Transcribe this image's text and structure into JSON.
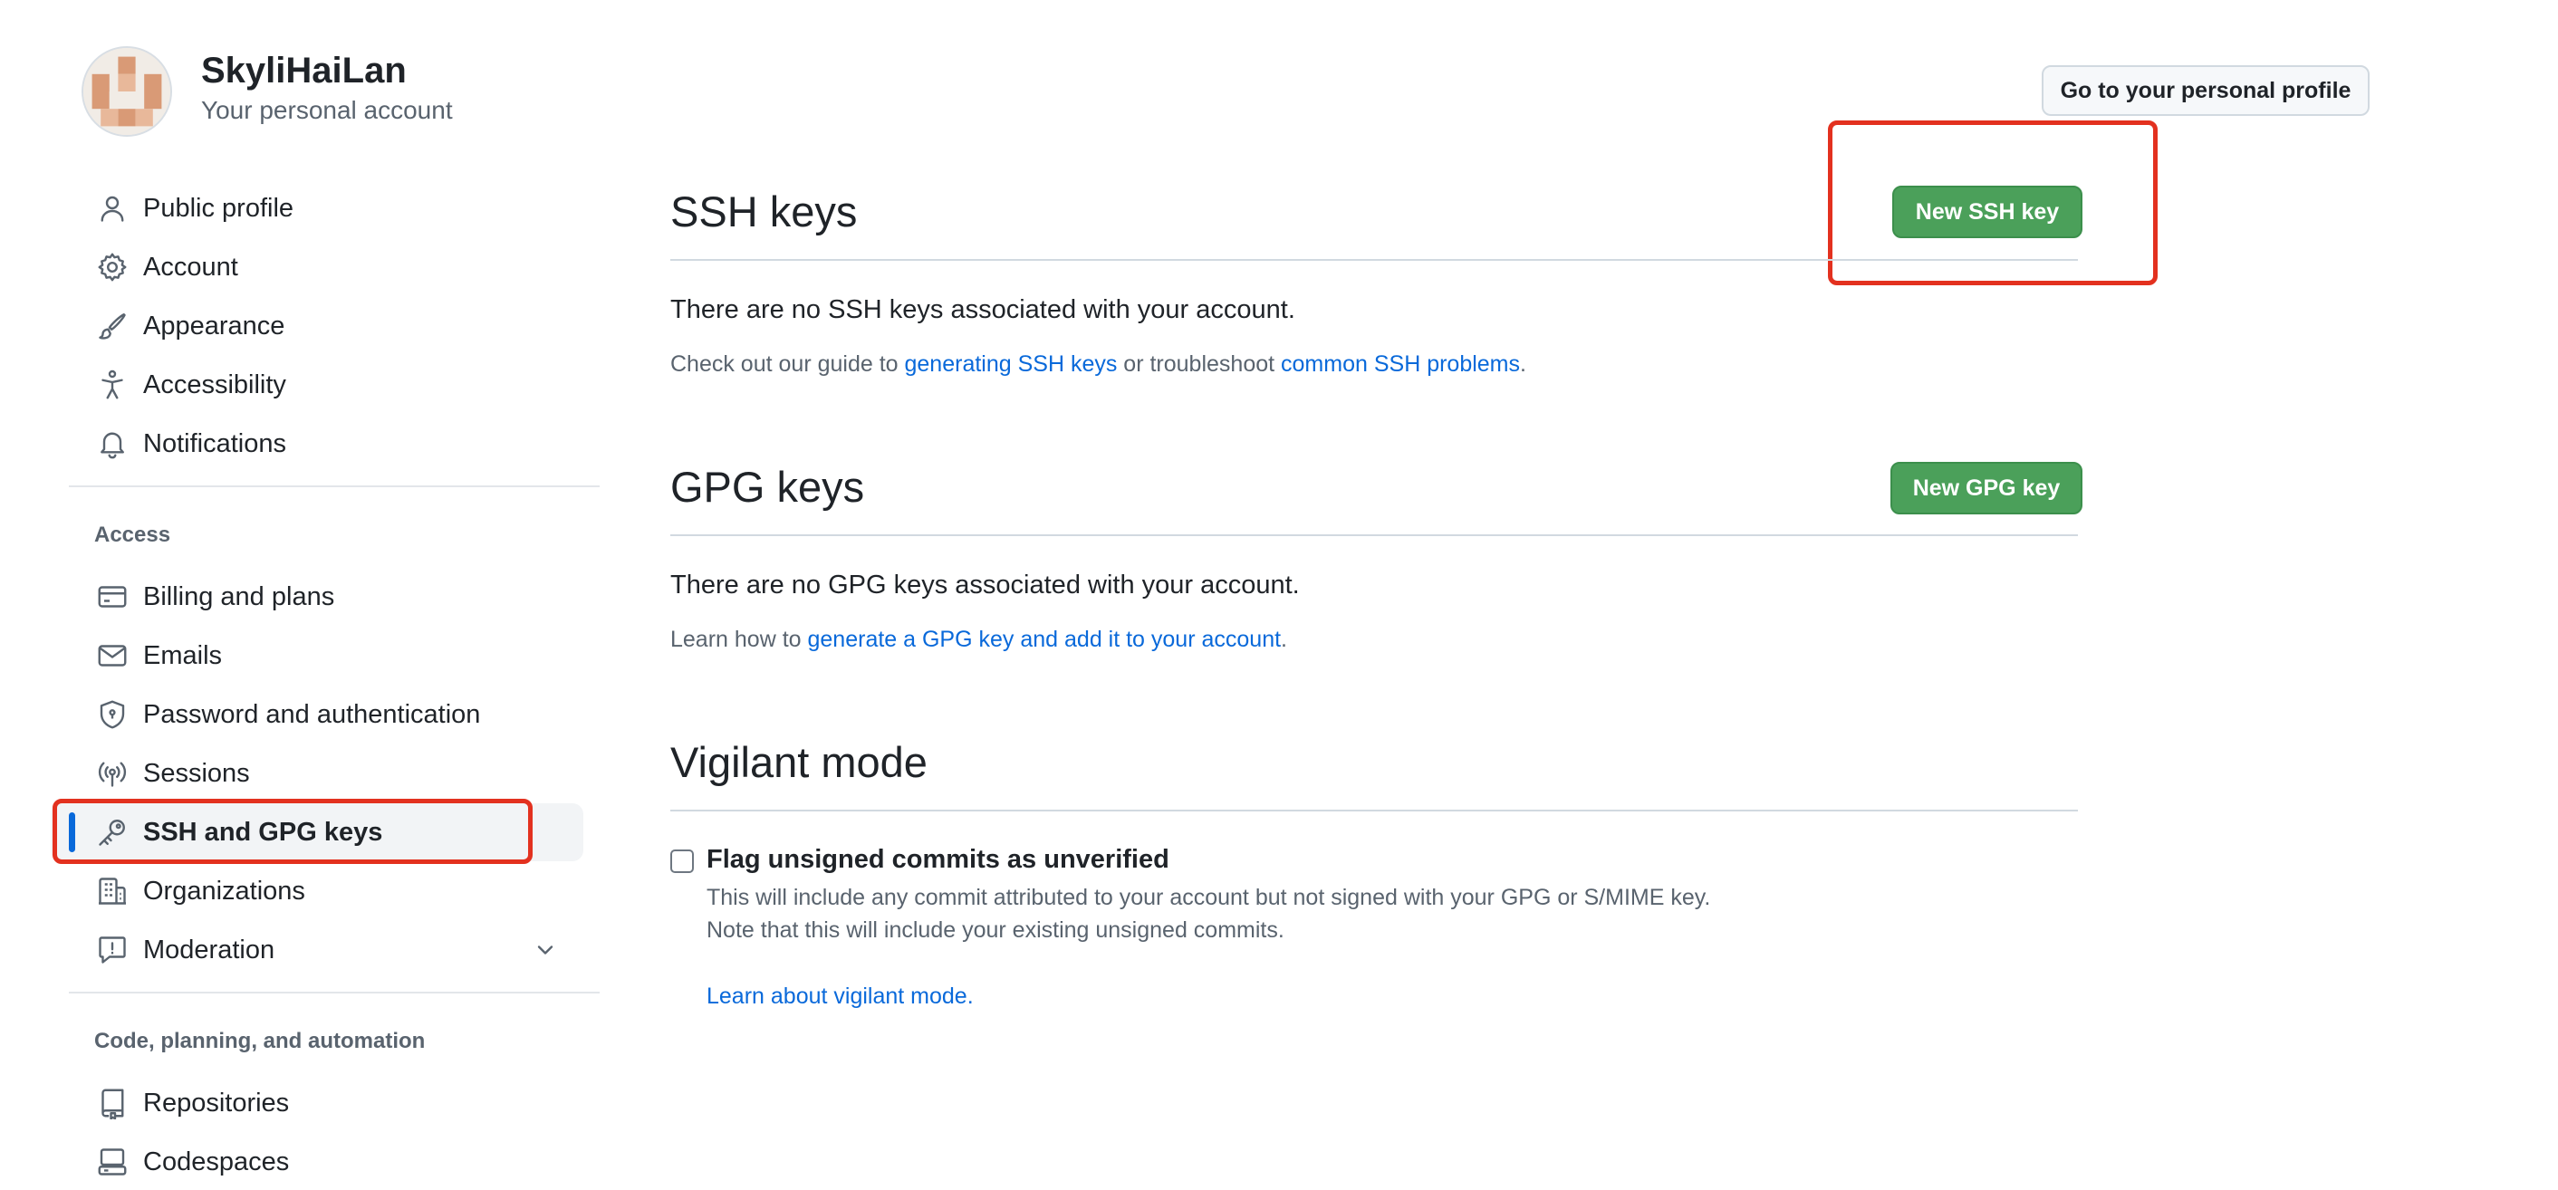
{
  "account": {
    "name": "SkyliHaiLan",
    "subtitle": "Your personal account",
    "profile_button": "Go to your personal profile"
  },
  "sidebar": {
    "items_top": [
      {
        "label": "Public profile",
        "icon": "person-icon"
      },
      {
        "label": "Account",
        "icon": "gear-icon"
      },
      {
        "label": "Appearance",
        "icon": "paintbrush-icon"
      },
      {
        "label": "Accessibility",
        "icon": "accessibility-icon"
      },
      {
        "label": "Notifications",
        "icon": "bell-icon"
      }
    ],
    "access_heading": "Access",
    "items_access": [
      {
        "label": "Billing and plans",
        "icon": "credit-card-icon"
      },
      {
        "label": "Emails",
        "icon": "mail-icon"
      },
      {
        "label": "Password and authentication",
        "icon": "shield-lock-icon"
      },
      {
        "label": "Sessions",
        "icon": "broadcast-icon"
      },
      {
        "label": "SSH and GPG keys",
        "icon": "key-icon",
        "active": true
      },
      {
        "label": "Organizations",
        "icon": "organization-icon"
      },
      {
        "label": "Moderation",
        "icon": "report-icon"
      }
    ],
    "code_heading": "Code, planning, and automation",
    "items_code": [
      {
        "label": "Repositories",
        "icon": "repo-icon"
      },
      {
        "label": "Codespaces",
        "icon": "codespaces-icon"
      }
    ]
  },
  "ssh": {
    "title": "SSH keys",
    "new_button": "New SSH key",
    "empty_text": "There are no SSH keys associated with your account.",
    "guide_prefix": "Check out our guide to ",
    "guide_link": "generating SSH keys",
    "guide_middle": " or troubleshoot ",
    "problems_link": "common SSH problems",
    "guide_suffix": "."
  },
  "gpg": {
    "title": "GPG keys",
    "new_button": "New GPG key",
    "empty_text": "There are no GPG keys associated with your account.",
    "learn_prefix": "Learn how to ",
    "learn_link": "generate a GPG key and add it to your account",
    "learn_suffix": "."
  },
  "vigilant": {
    "title": "Vigilant mode",
    "checkbox_label": "Flag unsigned commits as unverified",
    "checked": false,
    "desc_line1": "This will include any commit attributed to your account but not signed with your GPG or S/MIME key.",
    "desc_line2": "Note that this will include your existing unsigned commits.",
    "learn_link": "Learn about vigilant mode",
    "learn_suffix": "."
  },
  "colors": {
    "accent_blue": "#0969da",
    "button_green": "#4ba05a",
    "highlight_red": "#e3311f"
  }
}
